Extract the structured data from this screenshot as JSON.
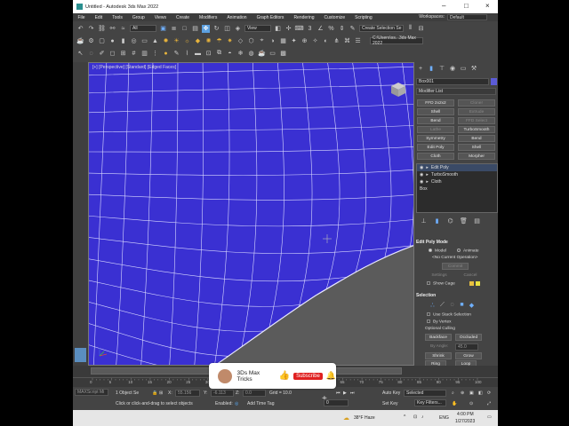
{
  "window": {
    "title": "Untitled - Autodesk 3ds Max 2022"
  },
  "menu": [
    "File",
    "Edit",
    "Tools",
    "Group",
    "Views",
    "Create",
    "Modifiers",
    "Animation",
    "Graph Editors",
    "Rendering",
    "Customize",
    "Scripting"
  ],
  "workspace": {
    "label": "Workspaces:",
    "value": "Default"
  },
  "toolbar": {
    "filter": "All",
    "view": "View",
    "selection_set": "Create Selection Se",
    "path": "C:\\Users\\ss...3ds Max 2022"
  },
  "viewport": {
    "label": "[+] [Perspective] [Standard] [Edged Faces]"
  },
  "command_panel": {
    "object_name": "Box001",
    "modifier_list": "Modifier List",
    "buttons": [
      "FFD 2x2x2",
      "Cloner",
      "Shell",
      "Extrude",
      "Bend",
      "FFD Select",
      "Lathe",
      "TurboSmooth",
      "Symmetry",
      "Bend",
      "Edit Poly",
      "Shell",
      "Cloth",
      "Morpher"
    ],
    "stack": [
      "Edit Poly",
      "TurboSmooth",
      "Cloth",
      "Box"
    ],
    "edit_poly_mode": {
      "title": "Edit Poly Mode",
      "model": "Model",
      "animate": "Animate",
      "operation": "<No Current Operation>",
      "commit": "Commit",
      "settings": "Settings",
      "cancel": "Cancel",
      "show_cage": "Show Cage"
    },
    "selection": {
      "title": "Selection",
      "use_stack": "Use Stack Selection",
      "by_vertex": "By Vertex",
      "optional_culling": "Optional Culling",
      "backface": "Backface",
      "occluded": "Occluded",
      "by_angle": "By Angle:",
      "angle": "45.0",
      "shrink": "Shrink",
      "grow": "Grow",
      "ring": "Ring",
      "loop": "Loop"
    }
  },
  "timeline": {
    "frame": "0 / 100",
    "ticks": [
      "0",
      "5",
      "10",
      "15",
      "20",
      "25",
      "30",
      "35",
      "40",
      "45",
      "50",
      "55",
      "60",
      "65",
      "70",
      "75",
      "80",
      "85",
      "90",
      "95",
      "100"
    ]
  },
  "status": {
    "selected": "1 Object Se",
    "prompt": "Click or click-and-drag to select objects",
    "maxscript": "MAXScript Mi",
    "x": "55.156",
    "y": "-6.113",
    "z": "0.0",
    "grid": "Grid = 10.0",
    "enabled": "Enabled:",
    "add_time_tag": "Add Time Tag",
    "auto_key": "Auto Key",
    "set_key": "Set Key",
    "selected_dd": "Selected",
    "key_filters": "Key Filters..."
  },
  "overlay": {
    "channel": "3Ds Max Tricks",
    "subscribe": "Subscribe"
  },
  "taskbar": {
    "weather": "38°F Haze",
    "lang": "ENG",
    "time": "4:00 PM",
    "date": "1/27/2023"
  }
}
